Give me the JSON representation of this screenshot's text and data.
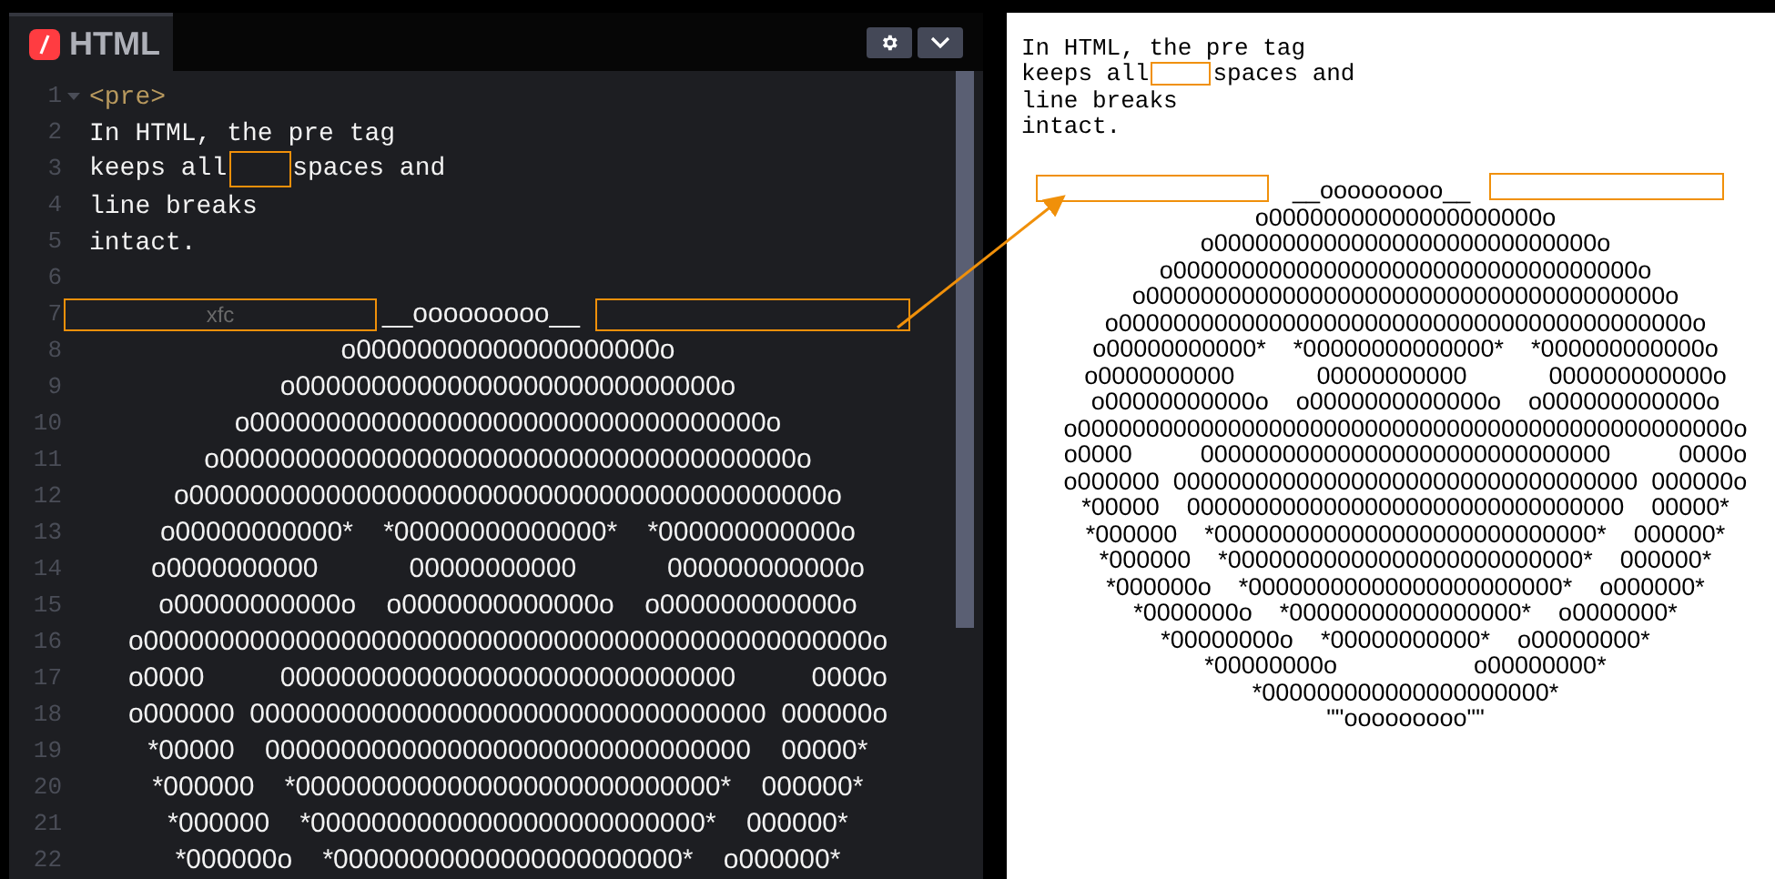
{
  "editor": {
    "tab": {
      "label": "HTML"
    },
    "lines": [
      {
        "number": "1",
        "kind": "tag",
        "text": "<pre>",
        "foldable": true
      },
      {
        "number": "2",
        "kind": "text",
        "text": "In HTML, the pre tag",
        "foldable": false
      },
      {
        "number": "3",
        "kind": "highlight",
        "before": "keeps all",
        "after": "spaces and",
        "foldable": false
      },
      {
        "number": "4",
        "kind": "text",
        "text": "line breaks",
        "foldable": false
      },
      {
        "number": "5",
        "kind": "text",
        "text": "intact.",
        "foldable": false
      },
      {
        "number": "6",
        "kind": "blank",
        "foldable": false
      },
      {
        "number": "7",
        "kind": "boxed",
        "text": "__ooooooooo__",
        "left_box_label": "xfc",
        "foldable": false
      },
      {
        "number": "8",
        "kind": "art",
        "text": "o00000000000000000000o",
        "foldable": false
      },
      {
        "number": "9",
        "kind": "art",
        "text": "o0000000000000000000000000000o",
        "foldable": false
      },
      {
        "number": "10",
        "kind": "art",
        "text": "o0000000000000000000000000000000000o",
        "foldable": false
      },
      {
        "number": "11",
        "kind": "art",
        "text": "o00000000000000000000000000000000000000o",
        "foldable": false
      },
      {
        "number": "12",
        "kind": "art",
        "text": "o000000000000000000000000000000000000000000o",
        "foldable": false
      },
      {
        "number": "13",
        "kind": "art",
        "text": "o00000000000*    *00000000000000*    *000000000000o",
        "foldable": false
      },
      {
        "number": "14",
        "kind": "art",
        "text": "o0000000000            00000000000            000000000000o",
        "foldable": false
      },
      {
        "number": "15",
        "kind": "art",
        "text": "o00000000000o    o0000000000000o    o000000000000o",
        "foldable": false
      },
      {
        "number": "16",
        "kind": "art",
        "text": "o000000000000000000000000000000000000000000000000o",
        "foldable": false
      },
      {
        "number": "17",
        "kind": "art",
        "text": "o0000          000000000000000000000000000000          0000o",
        "foldable": false
      },
      {
        "number": "18",
        "kind": "art",
        "text": "o000000  0000000000000000000000000000000000  000000o",
        "foldable": false
      },
      {
        "number": "19",
        "kind": "art",
        "text": "*00000    00000000000000000000000000000000    00000*",
        "foldable": false
      },
      {
        "number": "20",
        "kind": "art",
        "text": "*000000    *0000000000000000000000000000*    000000*",
        "foldable": false
      },
      {
        "number": "21",
        "kind": "art",
        "text": "*000000    *00000000000000000000000000*    000000*",
        "foldable": false
      },
      {
        "number": "22",
        "kind": "art",
        "text": "*000000o    *00000000000000000000000*    o000000*",
        "foldable": false
      }
    ]
  },
  "preview": {
    "lines": [
      {
        "kind": "text",
        "text": "In HTML, the pre tag"
      },
      {
        "kind": "highlight",
        "before": "keeps all",
        "after": "spaces and"
      },
      {
        "kind": "text",
        "text": "line breaks"
      },
      {
        "kind": "text",
        "text": "intact."
      },
      {
        "kind": "blank"
      },
      {
        "kind": "boxed",
        "text": "__ooooooooo__"
      },
      {
        "kind": "art",
        "text": "o00000000000000000000o"
      },
      {
        "kind": "art",
        "text": "o0000000000000000000000000000o"
      },
      {
        "kind": "art",
        "text": "o0000000000000000000000000000000000o"
      },
      {
        "kind": "art",
        "text": "o00000000000000000000000000000000000000o"
      },
      {
        "kind": "art",
        "text": "o000000000000000000000000000000000000000000o"
      },
      {
        "kind": "art",
        "text": "o00000000000*    *00000000000000*    *000000000000o"
      },
      {
        "kind": "art",
        "text": "o0000000000            00000000000            000000000000o"
      },
      {
        "kind": "art",
        "text": "o00000000000o    o0000000000000o    o000000000000o"
      },
      {
        "kind": "art",
        "text": "o000000000000000000000000000000000000000000000000o"
      },
      {
        "kind": "art",
        "text": "o0000          000000000000000000000000000000          0000o"
      },
      {
        "kind": "art",
        "text": "o000000  0000000000000000000000000000000000  000000o"
      },
      {
        "kind": "art",
        "text": "*00000    00000000000000000000000000000000    00000*"
      },
      {
        "kind": "art",
        "text": "*000000    *0000000000000000000000000000*    000000*"
      },
      {
        "kind": "art",
        "text": "*000000    *00000000000000000000000000*    000000*"
      },
      {
        "kind": "art",
        "text": "*000000o    *00000000000000000000000*    o000000*"
      },
      {
        "kind": "art",
        "text": "*0000000o    *00000000000000000*    o0000000*"
      },
      {
        "kind": "art",
        "text": "*00000000o    *00000000000*    o00000000*"
      },
      {
        "kind": "art",
        "text": "*00000000o                    o00000000*"
      },
      {
        "kind": "art",
        "text": "*000000000000000000000*"
      },
      {
        "kind": "art",
        "text": "\"\"ooooooooo\"\""
      }
    ]
  }
}
